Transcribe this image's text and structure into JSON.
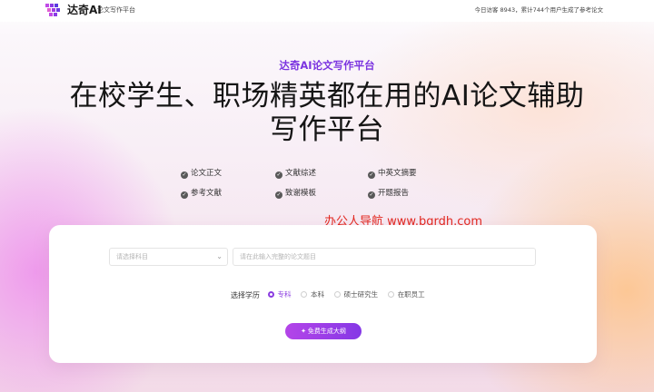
{
  "header": {
    "brand": "达奇AI",
    "brand_sub": "论文写作平台",
    "visit_stats": "今日访客 8943，累计744个用户生成了参考论文"
  },
  "hero": {
    "subtitle": "达奇AI论文写作平台",
    "headline_line1": "在校学生、职场精英都在用的AI论文辅助",
    "headline_line2": "写作平台"
  },
  "features": [
    "论文正文",
    "文献综述",
    "中英文摘要",
    "参考文献",
    "致谢模板",
    "开题报告"
  ],
  "watermark": "办公人导航 www.bgrdh.com",
  "form": {
    "subject_placeholder": "请选择科目",
    "topic_placeholder": "请在此输入完整的论文题目",
    "education_label": "选择学历",
    "education_options": [
      "专科",
      "本科",
      "硕士研究生",
      "在职员工"
    ],
    "education_selected": "专科",
    "submit_label": "免费生成大纲"
  },
  "colors": {
    "accent": "#8a3be0",
    "watermark": "#e2271e"
  }
}
